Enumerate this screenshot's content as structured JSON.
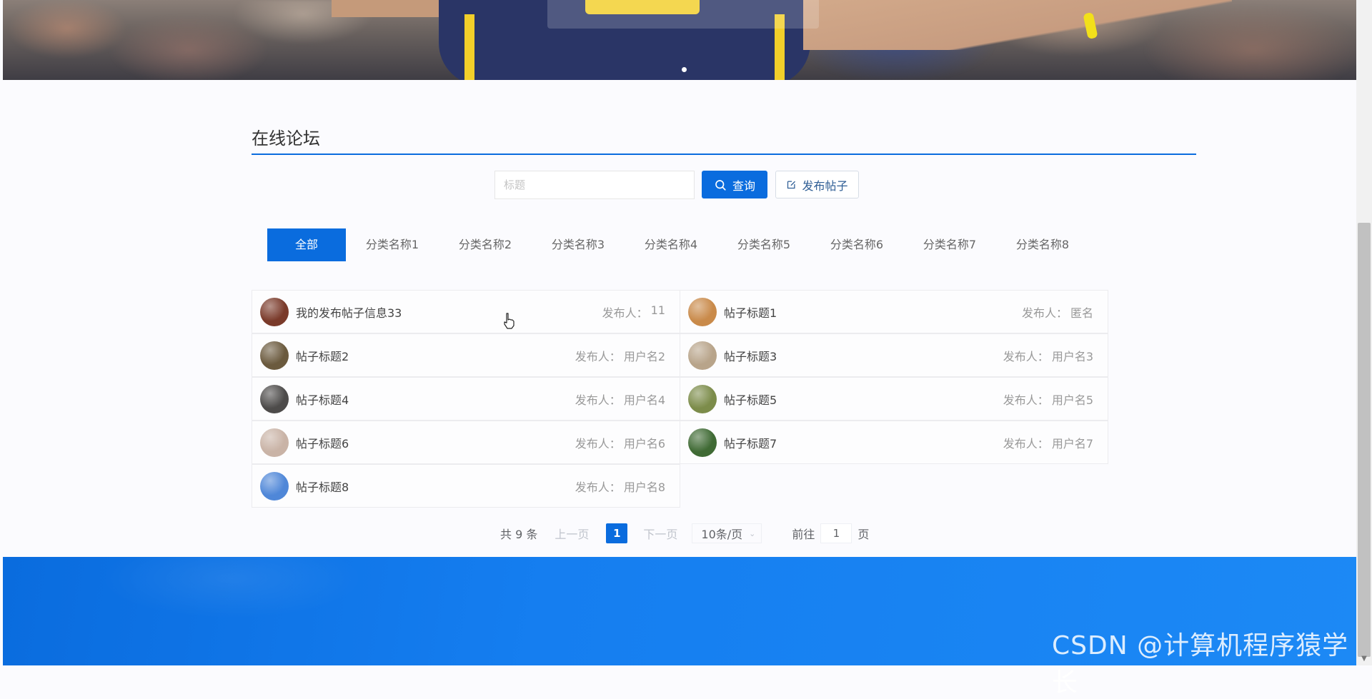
{
  "banner": {
    "carousel_indicator": "dot"
  },
  "section": {
    "title": "在线论坛"
  },
  "search": {
    "placeholder": "标题",
    "query_label": "查询",
    "publish_label": "发布帖子"
  },
  "categories": [
    {
      "label": "全部",
      "active": true
    },
    {
      "label": "分类名称1"
    },
    {
      "label": "分类名称2"
    },
    {
      "label": "分类名称3"
    },
    {
      "label": "分类名称4"
    },
    {
      "label": "分类名称5"
    },
    {
      "label": "分类名称6"
    },
    {
      "label": "分类名称7"
    },
    {
      "label": "分类名称8"
    }
  ],
  "posts": [
    {
      "title": "我的发布帖子信息33",
      "author_label": "发布人：",
      "author": "11",
      "avatar_color": "#7a3a2a"
    },
    {
      "title": "帖子标题1",
      "author_label": "发布人：",
      "author": "匿名",
      "avatar_color": "#c98a4a"
    },
    {
      "title": "帖子标题2",
      "author_label": "发布人：",
      "author": "用户名2",
      "avatar_color": "#6b5a3e"
    },
    {
      "title": "帖子标题3",
      "author_label": "发布人：",
      "author": "用户名3",
      "avatar_color": "#b8a48a"
    },
    {
      "title": "帖子标题4",
      "author_label": "发布人：",
      "author": "用户名4",
      "avatar_color": "#4d4b4a"
    },
    {
      "title": "帖子标题5",
      "author_label": "发布人：",
      "author": "用户名5",
      "avatar_color": "#7c8c4a"
    },
    {
      "title": "帖子标题6",
      "author_label": "发布人：",
      "author": "用户名6",
      "avatar_color": "#c9b3a6"
    },
    {
      "title": "帖子标题7",
      "author_label": "发布人：",
      "author": "用户名7",
      "avatar_color": "#3f6a34"
    },
    {
      "title": "帖子标题8",
      "author_label": "发布人：",
      "author": "用户名8",
      "avatar_color": "#4f87d8"
    }
  ],
  "pagination": {
    "total": "共 9 条",
    "prev": "上一页",
    "current": "1",
    "next": "下一页",
    "page_size": "10条/页",
    "goto_label": "前往",
    "goto_value": "1",
    "goto_suffix": "页"
  },
  "watermark": "CSDN @计算机程序猿学长",
  "colors": {
    "primary": "#0a6cde",
    "footer": "#1c89f5"
  }
}
